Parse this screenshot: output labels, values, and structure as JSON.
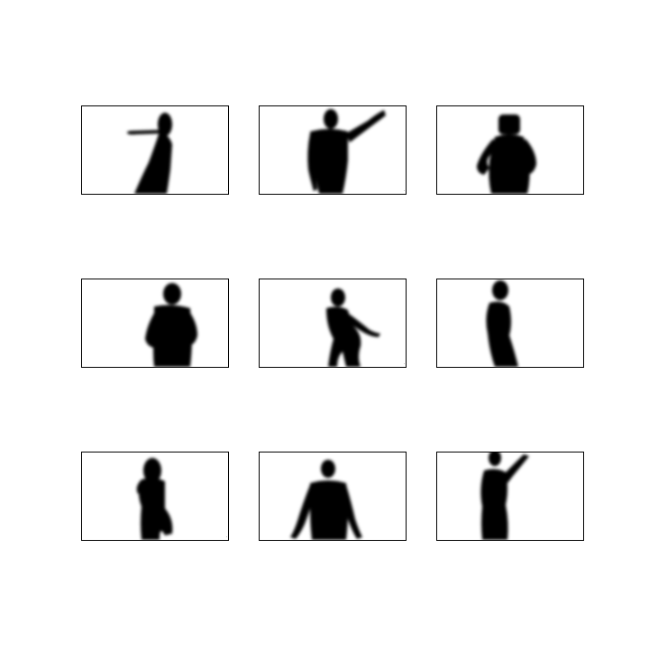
{
  "figure": {
    "background": "#ffffff",
    "silhouette_color": "#000000",
    "frame_color": "#000000",
    "panels": [
      {
        "id": "p1",
        "pose": "reaching-left",
        "watermark": "·"
      },
      {
        "id": "p2",
        "pose": "arm-raised-right",
        "watermark": "·"
      },
      {
        "id": "p3",
        "pose": "hands-on-hips",
        "watermark": ""
      },
      {
        "id": "p4",
        "pose": "hands-on-hips-side",
        "watermark": ""
      },
      {
        "id": "p5",
        "pose": "arm-extended-right",
        "watermark": "·"
      },
      {
        "id": "p6",
        "pose": "profile-standing",
        "watermark": ""
      },
      {
        "id": "p7",
        "pose": "turning",
        "watermark": "·"
      },
      {
        "id": "p8",
        "pose": "arms-down",
        "watermark": ""
      },
      {
        "id": "p9",
        "pose": "arm-raised-up",
        "watermark": ""
      }
    ]
  }
}
